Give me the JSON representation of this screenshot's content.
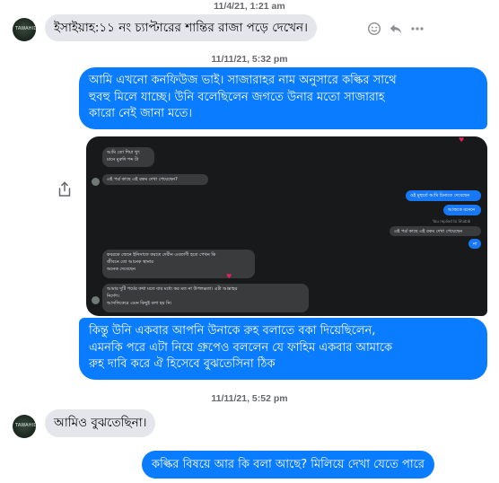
{
  "timestamps": [
    "11/4/21, 1:21 am",
    "11/11/21, 5:32 pm",
    "11/11/21, 5:52 pm"
  ],
  "contact": {
    "avatar_text": "TAWAHID"
  },
  "messages": {
    "m1": "ইসাইয়াহ:১১ নং চ্যাপ্টারের শান্তির রাজা পড়ে দেখেন।",
    "m2": [
      "আমি এখনো কনফিউজ ভাই। সাজারাহর নাম অনুসারে কল্কির সাথে",
      "হুবহু মিলে যাচ্ছে। উনি বলেছিলেন জগতে উনার মতো সাজারাহ",
      "কারো নেই জানা মতে।"
    ],
    "m3": [
      "কিন্তু উনি একবার আপনি উনাকে রুহ বলাতে বকা দিয়েছিলেন,",
      "এমনকি পরে এটা নিয়ে গ্রুপেও বললেন যে ফাহিম একবার আমাকে",
      "রুহ দাবি করে ঐ হিসেবে বুঝতেসিনা ঠিক"
    ],
    "m4": "আমিও বুঝতেছিনা।",
    "m5": "কল্কির বিষয়ে আর কি বলা আছে? মিলিয়ে দেখা যেতে পারে"
  },
  "icons": {
    "react": "smiley-icon",
    "reply": "reply-arrow-icon",
    "more": "more-dots-icon",
    "share": "share-icon"
  },
  "colors": {
    "outgoing": "#0a7cff",
    "incoming": "#e4e6eb",
    "timestamp": "#65676b",
    "screenshot_bg": "#18191a"
  },
  "screenshot": {
    "lines": [
      "আমি তো শিয়া খুৎ",
      "মানে মুরুদি শব্দ টা",
      "এই পর্ব্র কাছে এই রকম দেখা পেয়েছেন?",
      "ওই মুহুর্তে আমি চিনাতে দেবেছেন",
      "আজকে বনেনে",
      "You replied to Shabib",
      "এই পর্ব্র কাছে এই রকম দেখা পেয়েছেন",
      "না",
      "কবরকে জেনে ইনিসাফে করতে দেবীন এবতাণী হতে পেথন কি",
      "জীবনে তো আনেক স্থানার",
      "অনেক দেবেছেন",
      "আমার দুটি পর্মের কথা মতে যার মধ্যে কর মত না উপলব্ধতা। এটা আল্লাহর",
      "নির্দেশ।",
      "আসলিকেরে এমন কিছুই বলা হয় নি।"
    ]
  }
}
